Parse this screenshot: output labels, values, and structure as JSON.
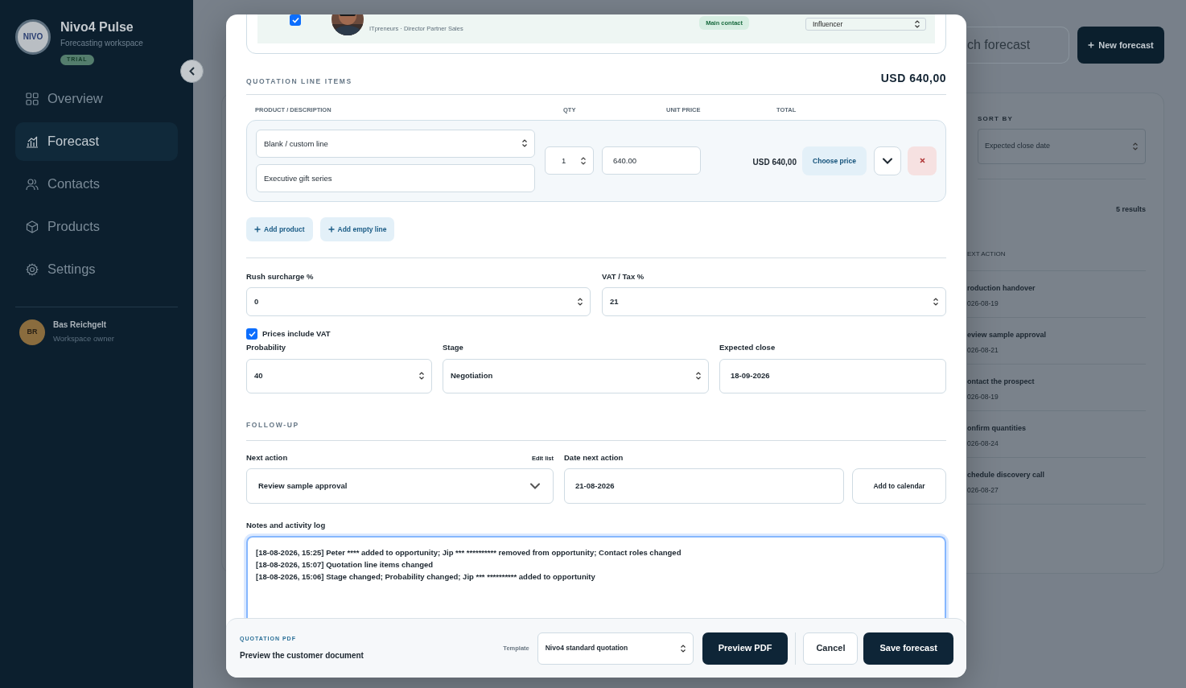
{
  "sidebar": {
    "logo_text": "NIVO",
    "title": "Nivo4 Pulse",
    "subtitle": "Forecasting workspace",
    "badge": "TRIAL",
    "items": [
      {
        "label": "Overview",
        "kind": "grid",
        "selected": false
      },
      {
        "label": "Forecast",
        "kind": "chart",
        "selected": true
      },
      {
        "label": "Contacts",
        "kind": "people",
        "selected": false
      },
      {
        "label": "Products",
        "kind": "cube",
        "selected": false
      },
      {
        "label": "Settings",
        "kind": "gear",
        "selected": false
      }
    ],
    "user": {
      "initials": "BR",
      "name": "Bas Reichgelt",
      "role": "Workspace owner"
    }
  },
  "background": {
    "search_placeholder": "ch forecast",
    "new_button": "New forecast",
    "sort_label": "SORT BY",
    "sort_value": "Expected close date",
    "results": "5 results",
    "column_header": "EXT ACTION",
    "rows": [
      {
        "title": "roduction handover",
        "date": "026-08-19"
      },
      {
        "title": "eview sample approval",
        "date": "026-08-21"
      },
      {
        "title": "ontact the prospect",
        "date": "026-08-19"
      },
      {
        "title": "onfirm quantities",
        "date": "026-08-24"
      },
      {
        "title": "chedule discovery call",
        "date": "026-08-27"
      }
    ]
  },
  "modal": {
    "contact": {
      "checked": true,
      "company": "ITpreneurs · Director Partner Sales",
      "badge": "Main contact",
      "role": "Influencer"
    },
    "line_items": {
      "title": "QUOTATION LINE ITEMS",
      "total": "USD 640,00",
      "columns": [
        "PRODUCT / DESCRIPTION",
        "QTY",
        "UNIT PRICE",
        "TOTAL"
      ],
      "items": [
        {
          "product": "Blank / custom line",
          "description": "Executive gift series",
          "qty": "1",
          "unit_price": "640.00",
          "total": "USD 640,00",
          "choose_price": "Choose price"
        }
      ],
      "add_buttons": [
        "Add product",
        "Add empty line"
      ]
    },
    "rush": {
      "label": "Rush surcharge %",
      "value": "0"
    },
    "vat": {
      "label": "VAT / Tax %",
      "value": "21"
    },
    "prices_include_vat": {
      "label": "Prices include VAT",
      "checked": true
    },
    "probability": {
      "label": "Probability",
      "value": "40"
    },
    "stage": {
      "label": "Stage",
      "value": "Negotiation"
    },
    "expected_close": {
      "label": "Expected close",
      "value": "18-09-2026"
    },
    "follow_up": {
      "title": "FOLLOW-UP",
      "next_action_label": "Next action",
      "edit_list": "Edit list",
      "next_action": "Review sample approval",
      "date_label": "Date next action",
      "date": "21-08-2026",
      "calendar_button": "Add to calendar"
    },
    "notes": {
      "label": "Notes and activity log",
      "lines": [
        "[18-08-2026, 15:25] Peter **** added to opportunity; Jip *** ********** removed from opportunity; Contact roles changed",
        "[18-08-2026, 15:07] Quotation line items changed",
        "[18-08-2026, 15:06] Stage changed; Probability changed; Jip *** ********** added to opportunity"
      ]
    },
    "footer": {
      "eyebrow": "QUOTATION PDF",
      "subtitle": "Preview the customer document",
      "template_label": "Template",
      "template": "Nivo4 standard quotation",
      "buttons": [
        {
          "label": "Preview PDF",
          "kind": "dark"
        },
        {
          "label": "Cancel",
          "kind": "outline"
        },
        {
          "label": "Save forecast",
          "kind": "dark"
        }
      ]
    }
  }
}
